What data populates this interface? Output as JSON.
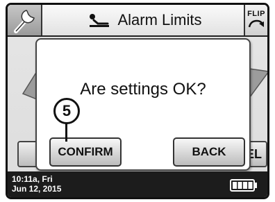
{
  "header": {
    "title": "Alarm Limits",
    "flip_label": "FLIP",
    "title_icon": "person-lying-icon",
    "tool_icon": "wrench-icon"
  },
  "background": {
    "right_button_label": "EL"
  },
  "dialog": {
    "message": "Are settings OK?",
    "confirm_label": "CONFIRM",
    "back_label": "BACK"
  },
  "callout": {
    "number": "5"
  },
  "status_bar": {
    "time_line1": "10:11a, Fri",
    "time_line2": "Jun 12, 2015",
    "battery_level": 1.0
  },
  "colors": {
    "status_bar_bg": "#1c1c1c",
    "dialog_bg": "#ffffff"
  }
}
